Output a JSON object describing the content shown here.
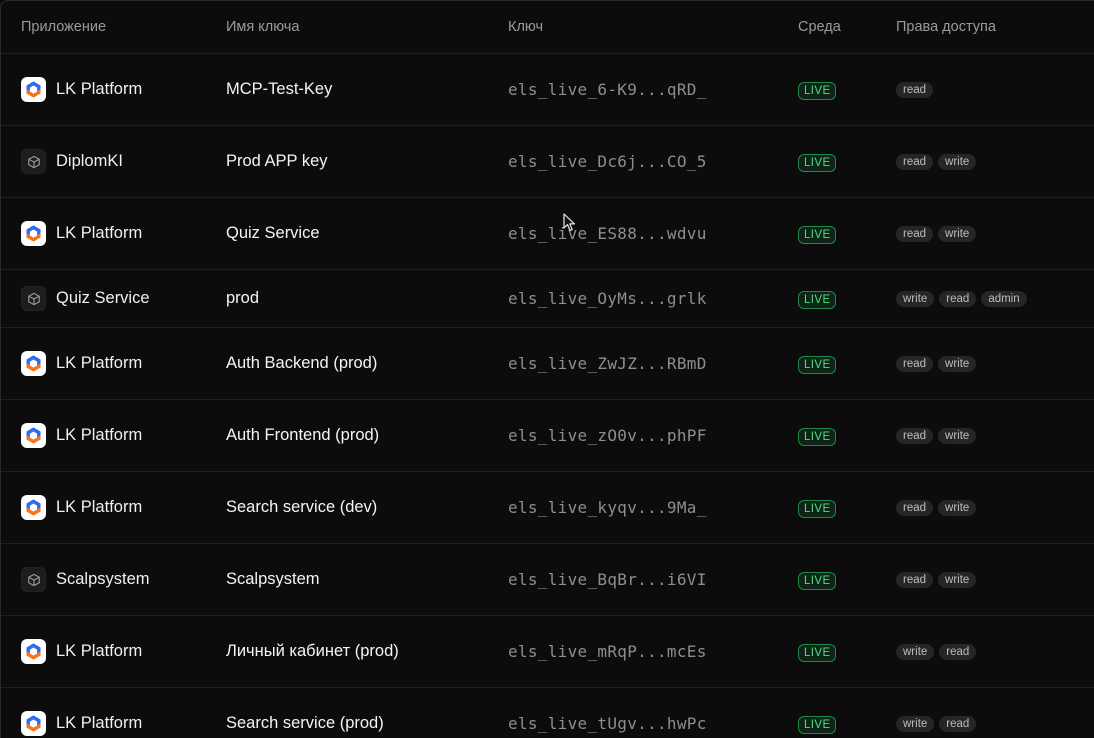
{
  "header": {
    "app": "Приложение",
    "name": "Имя ключа",
    "key": "Ключ",
    "env": "Среда",
    "perms": "Права доступа"
  },
  "colors": {
    "background": "#0c0c0c",
    "live_badge": "#4ade80",
    "logo_blue": "#2f6bf0",
    "logo_orange": "#f5731f"
  },
  "rows": [
    {
      "app": "LK Platform",
      "icon": "lk-platform-logo-icon",
      "name": "MCP-Test-Key",
      "key": "els_live_6-K9...qRD_",
      "env": "LIVE",
      "perms": [
        "read"
      ]
    },
    {
      "app": "DiplomKI",
      "icon": "cube-icon",
      "name": "Prod APP key",
      "key": "els_live_Dc6j...CO_5",
      "env": "LIVE",
      "perms": [
        "read",
        "write"
      ]
    },
    {
      "app": "LK Platform",
      "icon": "lk-platform-logo-icon",
      "name": "Quiz Service",
      "key": "els_live_ES88...wdvu",
      "env": "LIVE",
      "perms": [
        "read",
        "write"
      ]
    },
    {
      "app": "Quiz Service",
      "icon": "cube-icon",
      "name": "prod",
      "key": "els_live_OyMs...grlk",
      "env": "LIVE",
      "perms": [
        "write",
        "read",
        "admin"
      ]
    },
    {
      "app": "LK Platform",
      "icon": "lk-platform-logo-icon",
      "name": "Auth Backend (prod)",
      "key": "els_live_ZwJZ...RBmD",
      "env": "LIVE",
      "perms": [
        "read",
        "write"
      ]
    },
    {
      "app": "LK Platform",
      "icon": "lk-platform-logo-icon",
      "name": "Auth Frontend (prod)",
      "key": "els_live_zO0v...phPF",
      "env": "LIVE",
      "perms": [
        "read",
        "write"
      ]
    },
    {
      "app": "LK Platform",
      "icon": "lk-platform-logo-icon",
      "name": "Search service (dev)",
      "key": "els_live_kyqv...9Ma_",
      "env": "LIVE",
      "perms": [
        "read",
        "write"
      ]
    },
    {
      "app": "Scalpsystem",
      "icon": "cube-icon",
      "name": "Scalpsystem",
      "key": "els_live_BqBr...i6VI",
      "env": "LIVE",
      "perms": [
        "read",
        "write"
      ]
    },
    {
      "app": "LK Platform",
      "icon": "lk-platform-logo-icon",
      "name": "Личный кабинет (prod)",
      "key": "els_live_mRqP...mcEs",
      "env": "LIVE",
      "perms": [
        "write",
        "read"
      ]
    },
    {
      "app": "LK Platform",
      "icon": "lk-platform-logo-icon",
      "name": "Search service (prod)",
      "key": "els_live_tUgv...hwPc",
      "env": "LIVE",
      "perms": [
        "write",
        "read"
      ]
    }
  ]
}
